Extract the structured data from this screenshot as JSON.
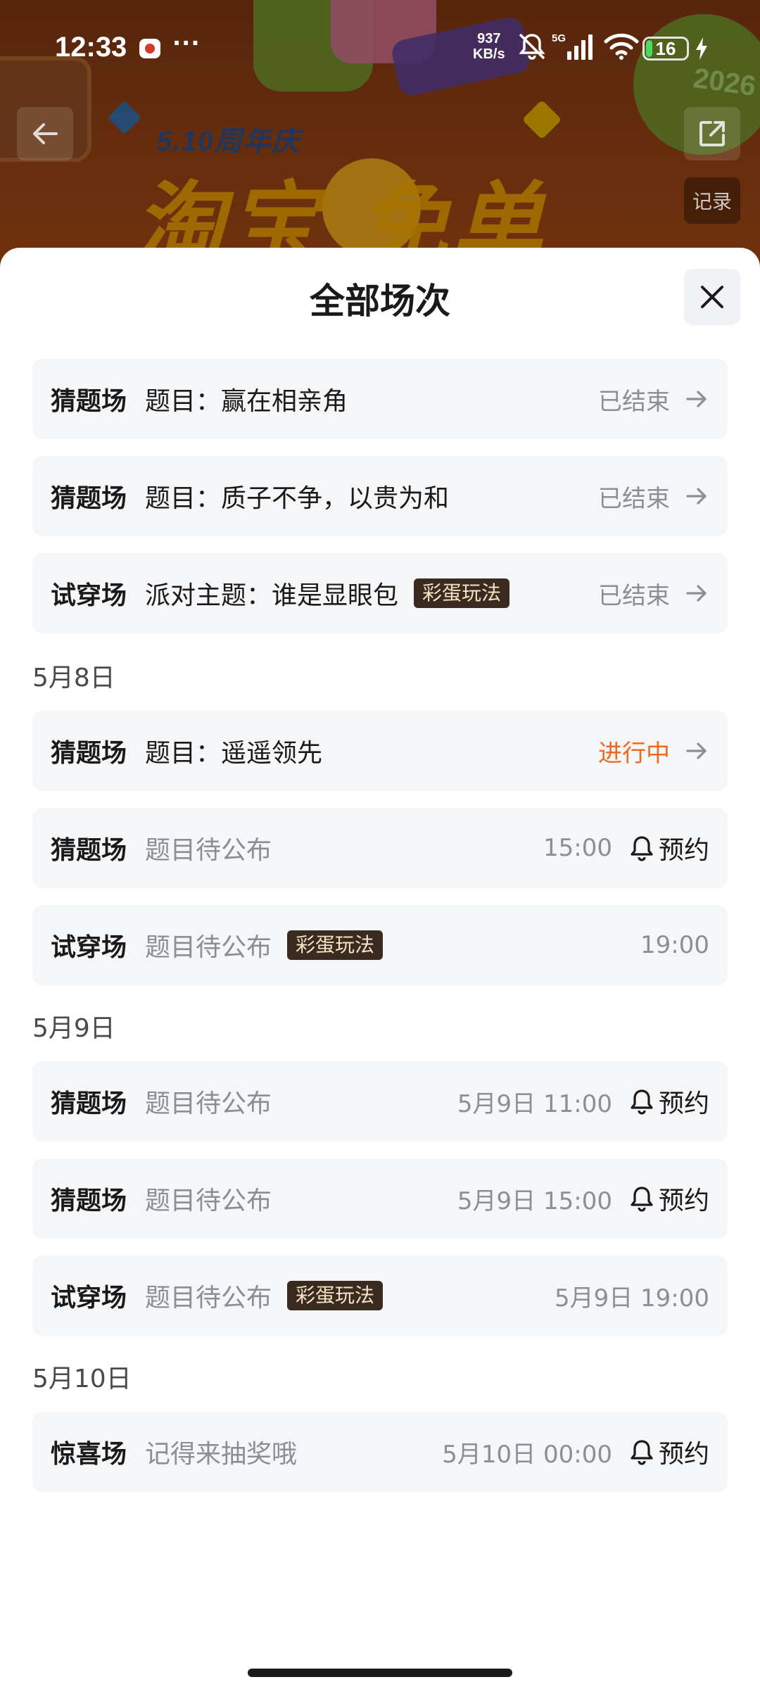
{
  "status_bar": {
    "time": "12:33",
    "more": "···",
    "net_speed_value": "937",
    "net_speed_unit": "KB/s",
    "network": "5G",
    "battery": "16",
    "battery_level": 0.16
  },
  "banner": {
    "promo_sub": "5.10周年庆",
    "promo_main": "淘宝 免单",
    "year": "2026",
    "record_label": "记录"
  },
  "sheet": {
    "title": "全部场次"
  },
  "sections": {
    "s1": {
      "date": ""
    },
    "s2": {
      "date": "5月8日"
    },
    "s3": {
      "date": "5月9日"
    },
    "s4": {
      "date": "5月10日"
    }
  },
  "rows": [
    {
      "type": "猜题场",
      "topic": "题目：赢在相亲角",
      "status": "已结束"
    },
    {
      "type": "猜题场",
      "topic": "题目：质子不争，以贵为和",
      "status": "已结束"
    },
    {
      "type": "试穿场",
      "topic": "派对主题：谁是显眼包",
      "tag": "彩蛋玩法",
      "status": "已结束"
    },
    {
      "type": "猜题场",
      "topic": "题目：遥遥领先",
      "status": "进行中"
    },
    {
      "type": "猜题场",
      "topic": "题目待公布",
      "time": "15:00",
      "remind": "预约"
    },
    {
      "type": "试穿场",
      "topic": "题目待公布",
      "tag": "彩蛋玩法",
      "time": "19:00"
    },
    {
      "type": "猜题场",
      "topic": "题目待公布",
      "time": "5月9日 11:00",
      "remind": "预约"
    },
    {
      "type": "猜题场",
      "topic": "题目待公布",
      "time": "5月9日 15:00",
      "remind": "预约"
    },
    {
      "type": "试穿场",
      "topic": "题目待公布",
      "tag": "彩蛋玩法",
      "time": "5月9日 19:00"
    },
    {
      "type": "惊喜场",
      "topic": "记得来抽奖哦",
      "time": "5月10日 00:00",
      "remind": "预约"
    }
  ],
  "colors": {
    "live_status": "#f06a1c",
    "muted_text": "#8a8e96",
    "tag_bg": "#3b2a20",
    "tag_text": "#f6e2c2",
    "row_bg": "#f5f6f8"
  }
}
